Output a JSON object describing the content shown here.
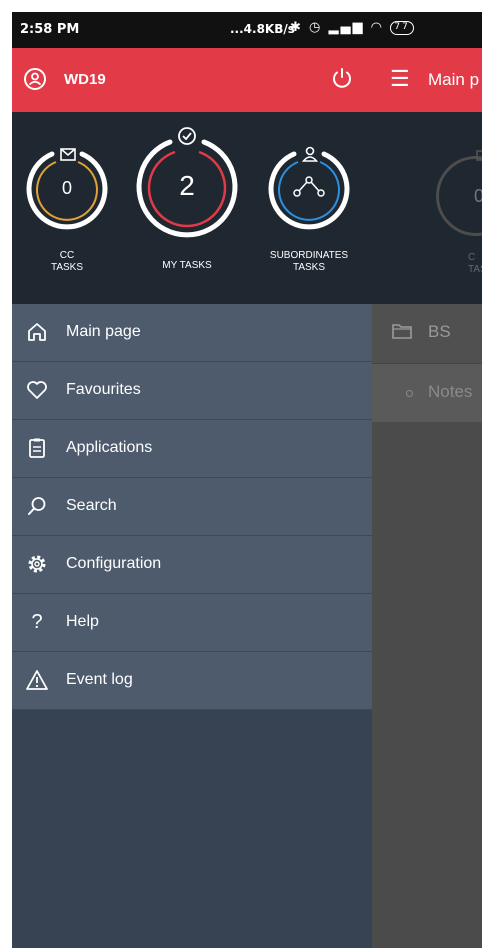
{
  "statusbar": {
    "time": "2:58 PM",
    "speed": "...4.8KB/s",
    "battery": "77"
  },
  "background_page": {
    "title": "Main p",
    "cc_label": "CC\nTAS",
    "items": [
      "BS",
      "Notes"
    ]
  },
  "drawer": {
    "username": "WD19",
    "stats": {
      "cc": {
        "count": "0",
        "label_line1": "CC",
        "label_line2": "TASKS",
        "color": "#e0a13a"
      },
      "mine": {
        "count": "2",
        "label": "MY TASKS",
        "color": "#e33a47"
      },
      "subordinates": {
        "label_line1": "SUBORDINATES",
        "label_line2": "TASKS",
        "color": "#2d8fe0"
      }
    },
    "menu": [
      {
        "label": "Main page",
        "icon": "home-icon"
      },
      {
        "label": "Favourites",
        "icon": "heart-icon"
      },
      {
        "label": "Applications",
        "icon": "clipboard-icon"
      },
      {
        "label": "Search",
        "icon": "search-icon"
      },
      {
        "label": "Configuration",
        "icon": "gear-icon"
      },
      {
        "label": "Help",
        "icon": "help-icon"
      },
      {
        "label": "Event log",
        "icon": "warning-icon"
      }
    ]
  },
  "colors": {
    "accent": "#e33a47",
    "drawer_bg": "#374353",
    "stats_bg": "#1f2731",
    "menu_item_bg": "#4d5b6d"
  }
}
